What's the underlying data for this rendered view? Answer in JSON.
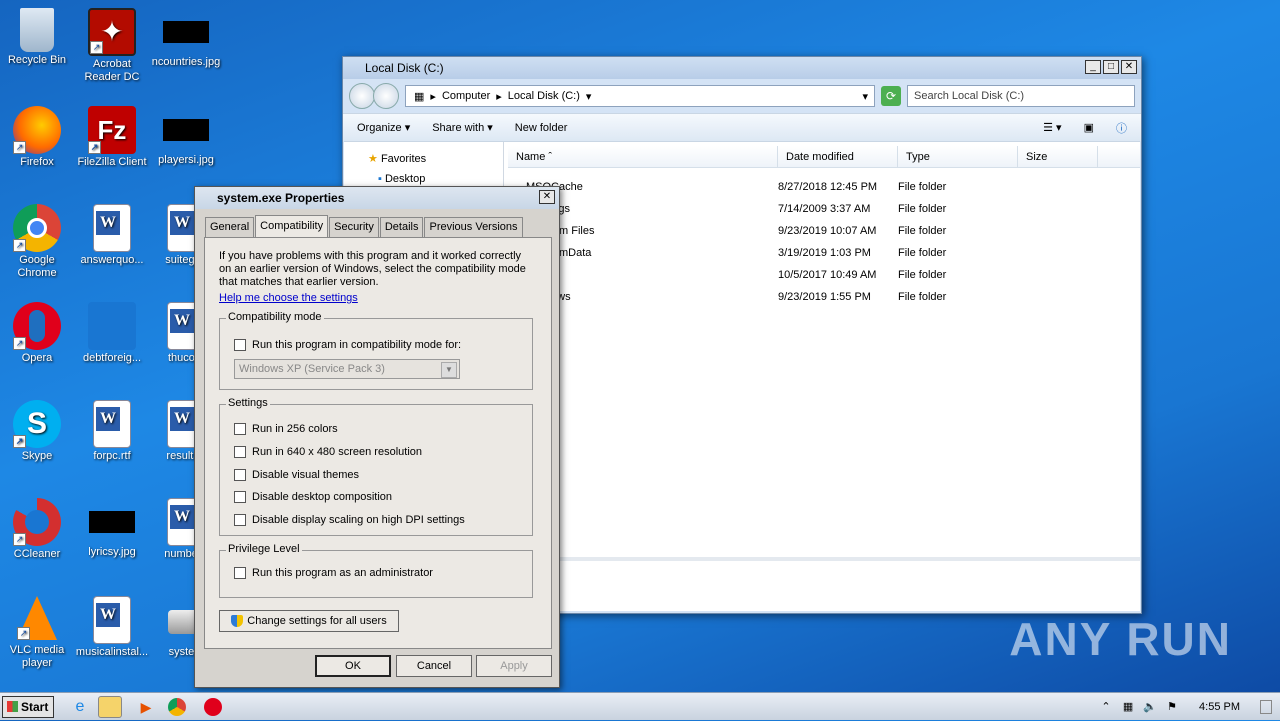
{
  "desktop": {
    "icons": [
      {
        "label": "Recycle Bin",
        "icon": "recycle-bin-icon"
      },
      {
        "label": "Acrobat Reader DC",
        "icon": "acrobat-icon"
      },
      {
        "label": "ncountries.jpg",
        "icon": "jpg-file-icon"
      },
      {
        "label": "Firefox",
        "icon": "firefox-icon"
      },
      {
        "label": "FileZilla Client",
        "icon": "filezilla-icon"
      },
      {
        "label": "playersi.jpg",
        "icon": "jpg-file-icon"
      },
      {
        "label": "Google Chrome",
        "icon": "chrome-icon"
      },
      {
        "label": "answerquo...",
        "icon": "word-doc-icon"
      },
      {
        "label": "suitegen",
        "icon": "word-doc-icon"
      },
      {
        "label": "Opera",
        "icon": "opera-icon"
      },
      {
        "label": "debtforeig...",
        "icon": "file-icon"
      },
      {
        "label": "thucom",
        "icon": "word-doc-icon"
      },
      {
        "label": "Skype",
        "icon": "skype-icon"
      },
      {
        "label": "forpc.rtf",
        "icon": "word-doc-icon"
      },
      {
        "label": "resultan",
        "icon": "word-doc-icon"
      },
      {
        "label": "CCleaner",
        "icon": "ccleaner-icon"
      },
      {
        "label": "lyricsy.jpg",
        "icon": "jpg-file-icon"
      },
      {
        "label": "numberp",
        "icon": "word-doc-icon"
      },
      {
        "label": "VLC media player",
        "icon": "vlc-icon"
      },
      {
        "label": "musicalinstal...",
        "icon": "word-doc-icon"
      },
      {
        "label": "system",
        "icon": "exe-file-icon"
      }
    ]
  },
  "watermark": "ANY RUN",
  "explorer": {
    "title": "Local Disk (C:)",
    "breadcrumb": [
      "Computer",
      "Local Disk (C:)"
    ],
    "search_placeholder": "Search Local Disk (C:)",
    "toolbar": {
      "organize": "Organize",
      "share_with": "Share with",
      "new_folder": "New folder"
    },
    "nav": {
      "favorites": "Favorites",
      "desktop": "Desktop"
    },
    "columns": {
      "name": "Name",
      "date": "Date modified",
      "type": "Type",
      "size": "Size"
    },
    "rows": [
      {
        "name": "MSOCache",
        "date": "8/27/2018 12:45 PM",
        "type": "File folder"
      },
      {
        "name": "PerfLogs",
        "date": "7/14/2009 3:37 AM",
        "type": "File folder"
      },
      {
        "name": "Program Files",
        "date": "9/23/2019 10:07 AM",
        "type": "File folder"
      },
      {
        "name": "ProgramData",
        "date": "3/19/2019 1:03 PM",
        "type": "File folder"
      },
      {
        "name": "Users",
        "date": "10/5/2017 10:49 AM",
        "type": "File folder"
      },
      {
        "name": "Windows",
        "date": "9/23/2019 1:55 PM",
        "type": "File folder"
      }
    ]
  },
  "dialog": {
    "title": "system.exe Properties",
    "tabs": [
      "General",
      "Compatibility",
      "Security",
      "Details",
      "Previous Versions"
    ],
    "intro": "If you have problems with this program and it worked correctly on an earlier version of Windows, select the compatibility mode that matches that earlier version.",
    "help_link": "Help me choose the settings",
    "compat_group": "Compatibility mode",
    "compat_checkbox": "Run this program in compatibility mode for:",
    "compat_select": "Windows XP (Service Pack 3)",
    "settings_group": "Settings",
    "settings": [
      "Run in 256 colors",
      "Run in 640 x 480 screen resolution",
      "Disable visual themes",
      "Disable desktop composition",
      "Disable display scaling on high DPI settings"
    ],
    "privilege_group": "Privilege Level",
    "privilege_checkbox": "Run this program as an administrator",
    "all_users_button": "Change settings for all users",
    "ok": "OK",
    "cancel": "Cancel",
    "apply": "Apply"
  },
  "taskbar": {
    "start": "Start",
    "clock": "4:55 PM"
  }
}
